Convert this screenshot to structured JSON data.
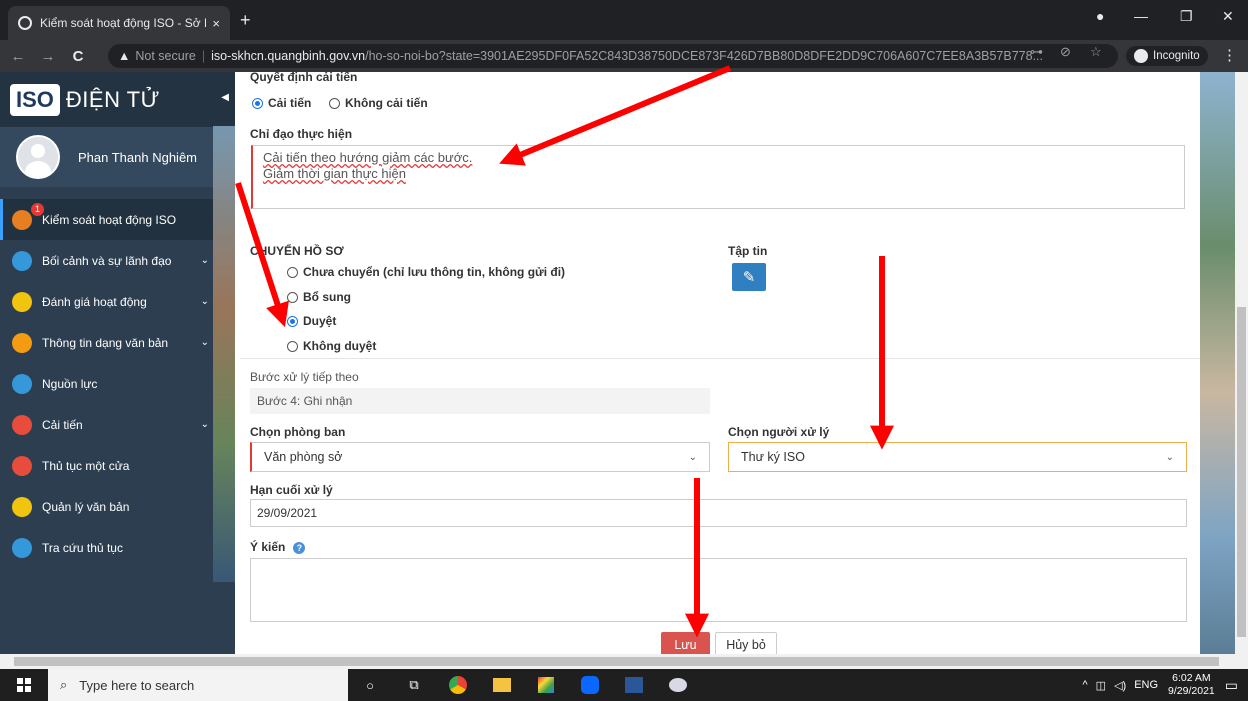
{
  "browser": {
    "tab_title": "Kiểm soát hoạt động ISO - Sở Kh",
    "tab_close": "×",
    "new_tab": "+",
    "back_icon": "←",
    "forward_icon": "→",
    "reload_icon": "C",
    "warn_icon": "▲",
    "not_secure": "Not secure",
    "separator": "|",
    "url_host": "iso-skhcn.quangbinh.gov.vn",
    "url_path": "/ho-so-noi-bo?state=3901AE295DF0FA52C843D38750DCE873F426D7BB80D8DFE2DD9C706A607C7EE8A3B57B778...",
    "key_icon": "⊶",
    "eye_icon": "⊘",
    "star_icon": "☆",
    "incognito": "Incognito",
    "menu_icon": "⋮",
    "min_icon": "—",
    "restore_icon": "❐",
    "close_icon": "✕"
  },
  "sidebar": {
    "logo_iso": "ISO",
    "logo_text": "ĐIỆN TỬ",
    "collapse_icon": "◀",
    "user_name": "Phan Thanh Nghiêm",
    "items": [
      {
        "label": "Kiểm soát hoạt động ISO",
        "color": "#e67e22",
        "badge": "1",
        "chevron": ""
      },
      {
        "label": "Bối cảnh và sự lãnh đạo",
        "color": "#3498db",
        "badge": "",
        "chevron": "⌄"
      },
      {
        "label": "Đánh giá hoạt động",
        "color": "#f1c40f",
        "badge": "",
        "chevron": "⌄"
      },
      {
        "label": "Thông tin dạng văn bản",
        "color": "#f39c12",
        "badge": "",
        "chevron": "⌄"
      },
      {
        "label": "Nguồn lực",
        "color": "#3498db",
        "badge": "",
        "chevron": ""
      },
      {
        "label": "Cải tiến",
        "color": "#e74c3c",
        "badge": "",
        "chevron": "⌄"
      },
      {
        "label": "Thủ tục một cửa",
        "color": "#e74c3c",
        "badge": "",
        "chevron": ""
      },
      {
        "label": "Quản lý văn bản",
        "color": "#f1c40f",
        "badge": "",
        "chevron": ""
      },
      {
        "label": "Tra cứu thủ tục",
        "color": "#3498db",
        "badge": "",
        "chevron": ""
      }
    ]
  },
  "form": {
    "decision_label": "Quyết định cải tiến",
    "decision_options": [
      {
        "label": "Cải tiến",
        "checked": true
      },
      {
        "label": "Không cải tiến",
        "checked": false
      }
    ],
    "direction_label": "Chỉ đạo thực hiện",
    "direction_lines": [
      "Cải tiến theo hướng giảm các bước.",
      "Giảm thời gian thực hiện"
    ],
    "transfer_label": "CHUYỂN HỒ SƠ",
    "transfer_options": [
      {
        "label": "Chưa chuyển (chỉ lưu thông tin, không gửi đi)",
        "checked": false
      },
      {
        "label": "Bổ sung",
        "checked": false
      },
      {
        "label": "Duyệt",
        "checked": true
      },
      {
        "label": "Không duyệt",
        "checked": false
      }
    ],
    "file_label": "Tập tin",
    "next_step_label": "Bước xử lý tiếp theo",
    "next_step_value": "Bước 4: Ghi nhận",
    "department_label": "Chọn phòng ban",
    "department_value": "Văn phòng sở",
    "handler_label": "Chọn người xử lý",
    "handler_value": "Thư ký ISO",
    "deadline_label": "Hạn cuối xử lý",
    "deadline_value": "29/09/2021",
    "opinion_label": "Ý kiến",
    "opinion_value": "",
    "save_label": "Lưu",
    "cancel_label": "Hủy bỏ"
  },
  "taskbar": {
    "search_placeholder": "Type here to search",
    "lang": "ENG",
    "time": "6:02 AM",
    "date": "9/29/2021"
  },
  "colors": {
    "arrow": "#ff0000",
    "accent": "#1a73e8",
    "save_button": "#d9534f",
    "sidebar_bg": "#2c3e50"
  }
}
